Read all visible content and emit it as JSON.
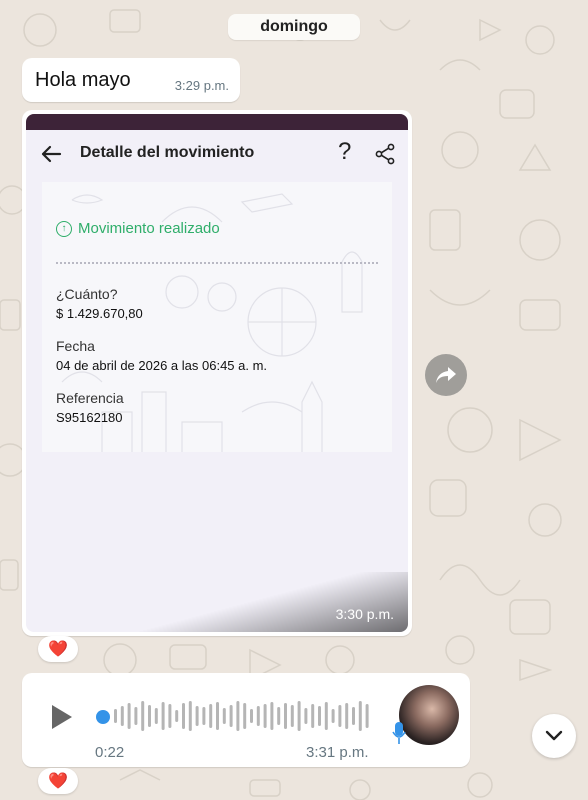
{
  "chat": {
    "date_label": "domingo",
    "message1": {
      "text": "Hola mayo",
      "time": "3:29 p.m."
    },
    "image_message": {
      "time": "3:30 p.m.",
      "screenshot": {
        "header_title": "Detalle del movimiento",
        "help_label": "?",
        "status": "Movimiento realizado",
        "fields": [
          {
            "label": "¿Cuánto?",
            "value": "$ 1.429.670,80"
          },
          {
            "label": "Fecha",
            "value": "04 de abril de 2026 a las 06:45 a. m."
          },
          {
            "label": "Referencia",
            "value": "S95162180"
          }
        ]
      },
      "reaction": "❤️"
    },
    "voice_message": {
      "duration": "0:22",
      "time": "3:31 p.m.",
      "reaction": "❤️"
    }
  },
  "colors": {
    "wallpaper": "#ece5dd",
    "status_green": "#2fae6a",
    "voice_accent": "#3493e8"
  },
  "icons": [
    "back-arrow-icon",
    "help-icon",
    "share-icon",
    "forward-icon",
    "play-icon",
    "mic-icon",
    "chevron-down-icon",
    "arrow-up-circle-icon"
  ]
}
